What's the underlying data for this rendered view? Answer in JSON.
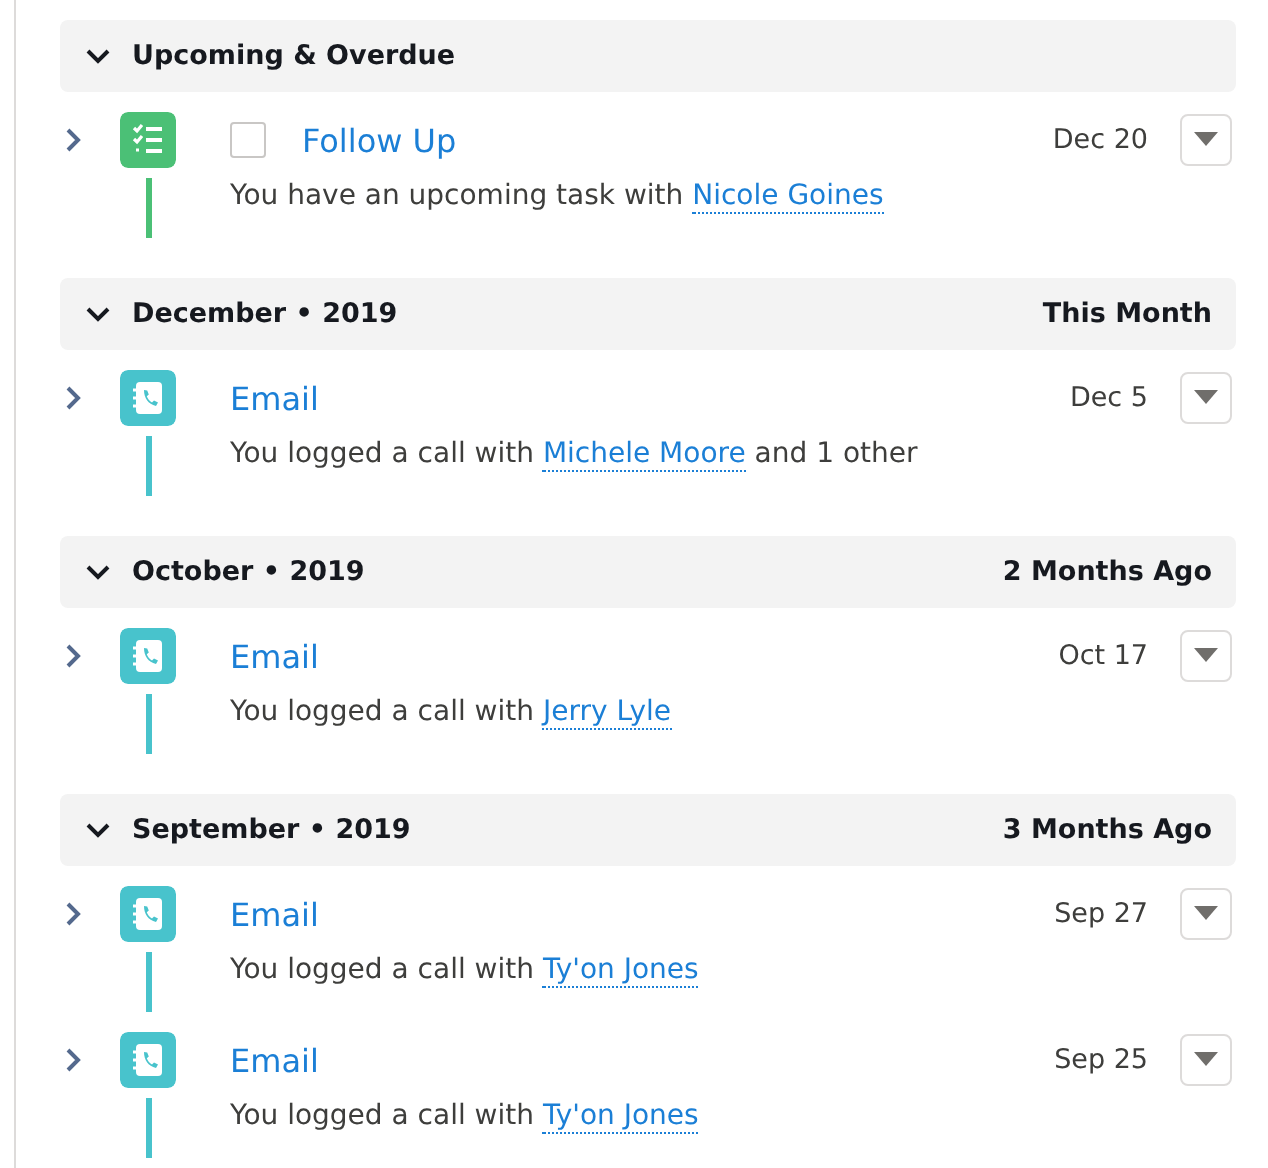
{
  "groups": [
    {
      "title": "Upcoming & Overdue",
      "expanded": true,
      "items": [
        {
          "kind": "task",
          "checked": false,
          "title": "Follow Up",
          "date": "Dec 20",
          "text": "You have an upcoming task with",
          "link": "Nicole Goines"
        }
      ]
    },
    {
      "title": "December • 2019",
      "expanded": true,
      "period": "This Month",
      "items": [
        {
          "kind": "call",
          "title": "Email",
          "date": "Dec 5",
          "text": "You logged a call with",
          "link": "Michele Moore",
          "suffix": "and 1 other"
        }
      ]
    },
    {
      "title": "October • 2019",
      "expanded": true,
      "period": "2 Months Ago",
      "items": [
        {
          "kind": "call",
          "title": "Email",
          "date": "Oct 17",
          "text": "You logged a call with",
          "link": "Jerry Lyle"
        }
      ]
    },
    {
      "title": "September • 2019",
      "expanded": true,
      "period": "3 Months Ago",
      "items": [
        {
          "kind": "call",
          "title": "Email",
          "date": "Sep 27",
          "text": "You logged a call with",
          "link": "Ty'on Jones"
        },
        {
          "kind": "call",
          "title": "Email",
          "date": "Sep 25",
          "text": "You logged a call with",
          "link": "Ty'on Jones"
        }
      ]
    }
  ]
}
